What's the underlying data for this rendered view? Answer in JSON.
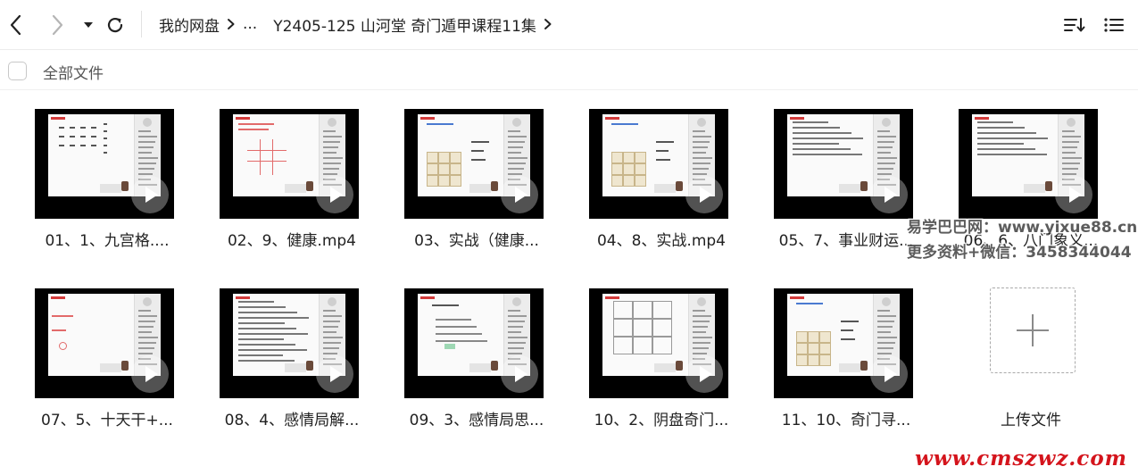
{
  "nav": {
    "back_icon": "chevron-left",
    "forward_icon": "chevron-right",
    "dropdown_icon": "caret-down",
    "refresh_icon": "refresh"
  },
  "breadcrumb": {
    "root": "我的网盘",
    "ellipsis": "...",
    "current": "Y2405-125 山河堂 奇门遁甲课程11集"
  },
  "toolbar": {
    "sort_icon": "sort-descending",
    "view_icon": "list-view"
  },
  "select_all": {
    "label": "全部文件"
  },
  "files": [
    {
      "name": "01、1、九宫格...."
    },
    {
      "name": "02、9、健康.mp4"
    },
    {
      "name": "03、实战（健康..."
    },
    {
      "name": "04、8、实战.mp4"
    },
    {
      "name": "05、7、事业财运..."
    },
    {
      "name": "06、6、八门象义..."
    },
    {
      "name": "07、5、十天干+..."
    },
    {
      "name": "08、4、感情局解..."
    },
    {
      "name": "09、3、感情局思..."
    },
    {
      "name": "10、2、阴盘奇门..."
    },
    {
      "name": "11、10、奇门寻..."
    }
  ],
  "upload": {
    "label": "上传文件",
    "icon": "plus"
  },
  "watermarks": {
    "line1": "易学巴巴网：www.yixue88.cn",
    "line2": "更多资料+微信：3458344044",
    "site": "www.cmszwz.com"
  },
  "colors": {
    "accent_red": "#d4141c",
    "thumbnail_bg": "#000000",
    "text": "#222222"
  }
}
